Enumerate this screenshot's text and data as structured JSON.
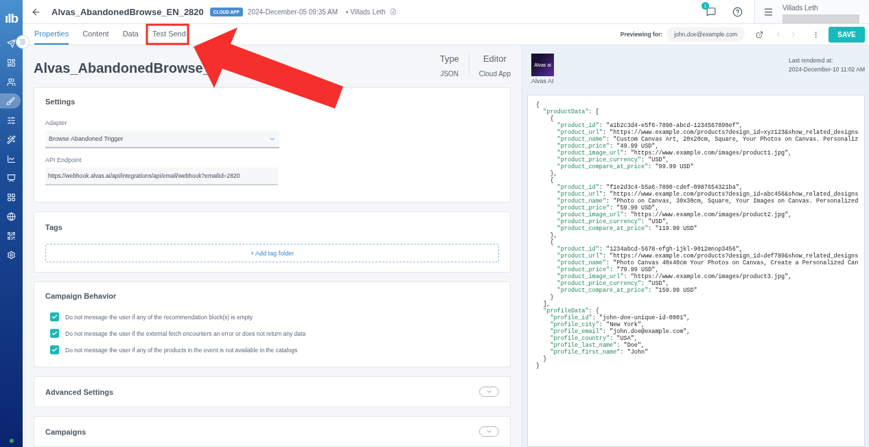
{
  "sidebar": {
    "logo": "ılb",
    "items": [
      {
        "selected": false
      },
      {
        "selected": false
      },
      {
        "selected": false
      },
      {
        "selected": true
      },
      {
        "selected": false
      },
      {
        "selected": false
      },
      {
        "selected": false
      },
      {
        "selected": false
      },
      {
        "selected": false
      },
      {
        "selected": false
      },
      {
        "selected": false
      },
      {
        "selected": false
      }
    ]
  },
  "header": {
    "title": "Alvas_AbandonedBrowse_EN_2820",
    "badge": "CLOUD APP",
    "date": "2024-December-05 09:35 AM",
    "author": "• Villads Leth",
    "notifications": "1",
    "user": "Villads Leth"
  },
  "tabs": [
    {
      "label": "Properties",
      "selected": true
    },
    {
      "label": "Content",
      "selected": false
    },
    {
      "label": "Data",
      "selected": false
    },
    {
      "label": "Test Send",
      "selected": false
    }
  ],
  "preview": {
    "label": "Previewing for:",
    "email": "john.doe@example.com",
    "save": "SAVE"
  },
  "page": {
    "heading": "Alvas_AbandonedBrowse_",
    "meta": [
      {
        "label": "Type",
        "value": "JSON"
      },
      {
        "label": "Editor",
        "value": "Cloud App"
      }
    ]
  },
  "settings": {
    "title": "Settings",
    "adapter_label": "Adapter",
    "adapter_value": "Browse Abandoned Trigger",
    "endpoint_label": "API Endpoint",
    "endpoint_value": "https://webhook.alvas.ai/api/integrations/api/email/webhook?emailId=2820"
  },
  "tags": {
    "title": "Tags",
    "add": "+ Add tag folder"
  },
  "behavior": {
    "title": "Campaign Behavior",
    "options": [
      {
        "label": "Do not message the user if any of the recommendation block(s) is empty",
        "checked": true
      },
      {
        "label": "Do not message the user if the external fetch encounters an error or does not return any data",
        "checked": true
      },
      {
        "label": "Do not message the user if any of the products in the event is not available in the catalogs",
        "checked": true
      }
    ]
  },
  "collapsed_sections": [
    {
      "title": "Advanced Settings",
      "expanded": false
    },
    {
      "title": "Campaigns",
      "expanded": false
    }
  ],
  "render": {
    "thumb_text": "Alvas ai",
    "app": "Alvas AI",
    "label": "Last rendered at:",
    "time": "2024-December-10 11:02 AM"
  },
  "code_lines": [
    "{",
    "  \"productData\": [",
    "    {",
    "      \"product_id\": \"a1b2c3d4-e5f6-7890-abcd-1234567890ef\",",
    "      \"product_url\": \"https://www.example.com/products?design_id=xyz123&show_related_designs",
    "      \"product_name\": \"Custom Canvas Art, 20x20cm, Square, Your Photos on Canvas. Personaliz",
    "      \"product_price\": \"49.99 USD\",",
    "      \"product_image_url\": \"https://www.example.com/images/product1.jpg\",",
    "      \"product_price_currency\": \"USD\",",
    "      \"product_compare_at_price\": \"99.99 USD\"",
    "    },",
    "    {",
    "      \"product_id\": \"f1e2d3c4-b5a6-7890-cdef-0987654321ba\",",
    "      \"product_url\": \"https://www.example.com/products?design_id=abc456&show_related_designs",
    "      \"product_name\": \"Photo on Canvas, 30x30cm, Square, Your Images on Canvas. Personalized",
    "      \"product_price\": \"59.99 USD\",",
    "      \"product_image_url\": \"https://www.example.com/images/product2.jpg\",",
    "      \"product_price_currency\": \"USD\",",
    "      \"product_compare_at_price\": \"119.99 USD\"",
    "    },",
    "    {",
    "      \"product_id\": \"1234abcd-5678-efgh-ijkl-9012mnop3456\",",
    "      \"product_url\": \"https://www.example.com/products?design_id=def789&show_related_designs",
    "      \"product_name\": \"Photo Canvas 40x40cm Your Photos on Canvas, Create a Personalized Can",
    "      \"product_price\": \"79.99 USD\",",
    "      \"product_image_url\": \"https://www.example.com/images/product3.jpg\",",
    "      \"product_price_currency\": \"USD\",",
    "      \"product_compare_at_price\": \"159.99 USD\"",
    "    }",
    "  ],",
    "  \"profileData\": {",
    "    \"profile_id\": \"john-doe-unique-id-0001\",",
    "    \"profile_city\": \"New York\",",
    "    \"profile_email\": \"john.doe@example.com\",",
    "    \"profile_country\": \"USA\",",
    "    \"profile_last_name\": \"Doe\",",
    "    \"profile_first_name\": \"John\"",
    "  }",
    "}"
  ]
}
